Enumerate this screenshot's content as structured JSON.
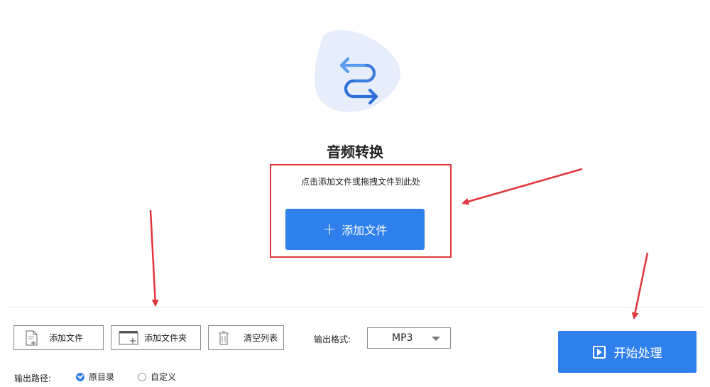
{
  "hero": {
    "icon": "convert-arrows-icon",
    "title": "音频转换",
    "hint": "点击添加文件或拖拽文件到此处",
    "add_button_plus": "+",
    "add_button_label": "添加文件"
  },
  "toolbar": {
    "add_file_label": "添加文件",
    "add_folder_label": "添加文件夹",
    "clear_list_label": "清空列表",
    "output_format_label": "输出格式:",
    "output_format_value": "MP3"
  },
  "start_button": {
    "label": "开始处理",
    "icon": "play-icon"
  },
  "output_path": {
    "label": "输出路径:",
    "options": [
      {
        "label": "原目录",
        "selected": true
      },
      {
        "label": "自定义",
        "selected": false
      }
    ]
  },
  "colors": {
    "accent": "#2f80ed",
    "highlight": "#e0363b",
    "hero_bg": "#e6eefc"
  }
}
